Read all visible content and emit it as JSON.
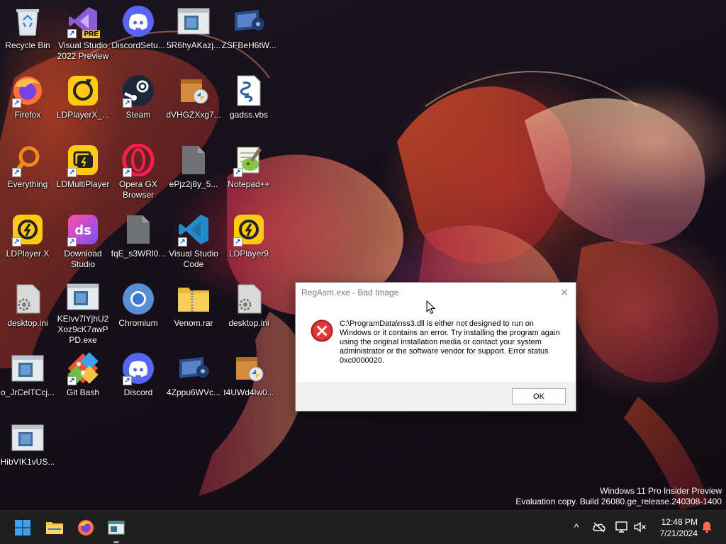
{
  "desktop_icons": [
    {
      "label": "Recycle Bin",
      "icon": "recycle-bin-icon",
      "shortcut": false
    },
    {
      "label": "Visual Studio 2022 Preview",
      "icon": "visual-studio-icon",
      "shortcut": true,
      "badge": "PRE"
    },
    {
      "label": "DiscordSetu...",
      "icon": "discord-icon",
      "shortcut": false
    },
    {
      "label": "5R6hyAKazj...",
      "icon": "exe-file-icon",
      "shortcut": false
    },
    {
      "label": "ZSFBeH6tW...",
      "icon": "installer-icon",
      "shortcut": false
    },
    {
      "label": "Firefox",
      "icon": "firefox-icon",
      "shortcut": true
    },
    {
      "label": "LDPlayerX_...",
      "icon": "ldplayer-installer-icon",
      "shortcut": false
    },
    {
      "label": "Steam",
      "icon": "steam-icon",
      "shortcut": true
    },
    {
      "label": "dVHGZXxg7...",
      "icon": "installer-box-icon",
      "shortcut": false
    },
    {
      "label": "gadss.vbs",
      "icon": "vbs-script-icon",
      "shortcut": false
    },
    {
      "label": "Everything",
      "icon": "everything-search-icon",
      "shortcut": true
    },
    {
      "label": "LDMultiPlayer",
      "icon": "ldmultiplayer-icon",
      "shortcut": true
    },
    {
      "label": "Opera GX Browser",
      "icon": "opera-gx-icon",
      "shortcut": true
    },
    {
      "label": "ePjz2j8y_5...",
      "icon": "blank-file-icon",
      "shortcut": false
    },
    {
      "label": "Notepad++",
      "icon": "notepadpp-icon",
      "shortcut": true
    },
    {
      "label": "LDPlayer X",
      "icon": "ldplayer-icon",
      "shortcut": true
    },
    {
      "label": "Download Studio",
      "icon": "download-studio-icon",
      "shortcut": true
    },
    {
      "label": "fqE_s3WRl0...",
      "icon": "blank-file-icon",
      "shortcut": false
    },
    {
      "label": "Visual Studio Code",
      "icon": "vscode-icon",
      "shortcut": true
    },
    {
      "label": "LDPlayer9",
      "icon": "ldplayer-icon",
      "shortcut": true
    },
    {
      "label": "desktop.ini",
      "icon": "settings-file-icon",
      "shortcut": false
    },
    {
      "label": "KElvv7lYjhU2Xoz9cK7awPPD.exe",
      "icon": "exe-file-icon",
      "shortcut": false
    },
    {
      "label": "Chromium",
      "icon": "chromium-icon",
      "shortcut": false
    },
    {
      "label": "Venom.rar",
      "icon": "zip-folder-icon",
      "shortcut": false
    },
    {
      "label": "desktop.ini",
      "icon": "settings-file-icon",
      "shortcut": false
    },
    {
      "label": "o_JrCelTCcj...",
      "icon": "exe-file-icon",
      "shortcut": false
    },
    {
      "label": "Git Bash",
      "icon": "git-bash-icon",
      "shortcut": true
    },
    {
      "label": "Discord",
      "icon": "discord-icon",
      "shortcut": true
    },
    {
      "label": "4Zppu6WVc...",
      "icon": "installer-icon",
      "shortcut": false
    },
    {
      "label": "t4UWd4lw0...",
      "icon": "installer-box-icon",
      "shortcut": false
    },
    {
      "label": "HibVIK1vUS...",
      "icon": "exe-file-icon",
      "shortcut": false
    }
  ],
  "dialog": {
    "title": "RegAsm.exe - Bad Image",
    "close_glyph": "✕",
    "icon": "error-icon",
    "message": "C:\\ProgramData\\nss3.dll is either not designed to run on Windows or it contains an error. Try installing the program again using the original installation media or contact your system administrator or the software vendor for support. Error status 0xc0000020.",
    "ok_label": "OK"
  },
  "watermark": {
    "line1": "Windows 11 Pro Insider Preview",
    "line2": "Evaluation copy. Build 26080.ge_release.240308-1400"
  },
  "taskbar": {
    "apps": [
      {
        "name": "start-button",
        "icon": "windows-logo-icon"
      },
      {
        "name": "file-explorer-button",
        "icon": "folder-icon"
      },
      {
        "name": "firefox-taskbar-button",
        "icon": "firefox-icon"
      },
      {
        "name": "regasm-taskbar-button",
        "icon": "app-window-icon",
        "active": true
      }
    ],
    "tray": {
      "chevron": "^",
      "time": "12:48 PM",
      "date": "7/21/2024"
    }
  },
  "colors": {
    "accent": "#0078d4",
    "error_red": "#d32f2f",
    "taskbar_bg": "#1f1f1f"
  }
}
